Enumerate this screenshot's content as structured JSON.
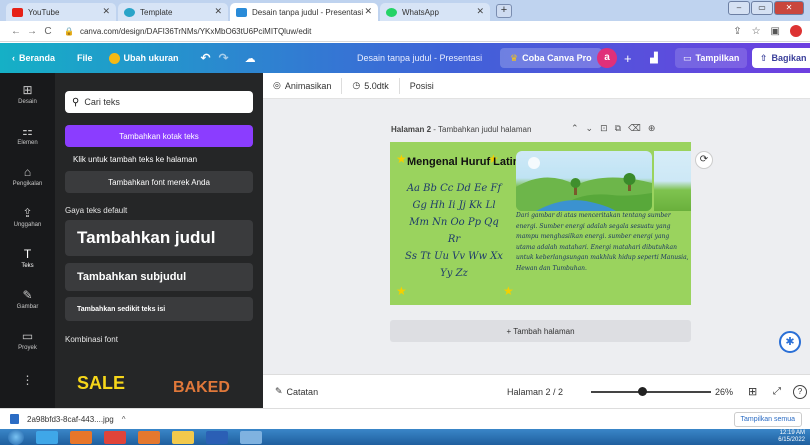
{
  "browser": {
    "tabs": [
      {
        "title": "YouTube",
        "favicon_color": "#e62117",
        "active": false
      },
      {
        "title": "Template",
        "favicon_color": "#2aa4c8",
        "active": false
      },
      {
        "title": "Desain tanpa judul - Presentasi",
        "favicon_color": "#2a8bd8",
        "active": true
      },
      {
        "title": "WhatsApp",
        "favicon_color": "#25d366",
        "active": false
      }
    ],
    "new_tab_label": "+",
    "url": "canva.com/design/DAFI36TrNMs/YKxMbO63tU6PciMITQluw/edit"
  },
  "canva_header": {
    "home_label": "Beranda",
    "file_label": "File",
    "resize_label": "Ubah ukuran",
    "doc_title": "Desain tanpa judul - Presentasi",
    "pro_label": "Coba Canva Pro",
    "user_initial": "a",
    "plus_label": "+",
    "present_label": "Tampilkan",
    "share_label": "Bagikan",
    "accent_color": "#8b3dff"
  },
  "rail": {
    "items": [
      {
        "label": "Desain",
        "icon": "layout-icon",
        "glyph": "⊞"
      },
      {
        "label": "Elemen",
        "icon": "elements-icon",
        "glyph": "⚏"
      },
      {
        "label": "Pengikalan",
        "icon": "brand-icon",
        "glyph": "⌂"
      },
      {
        "label": "Unggahan",
        "icon": "upload-icon",
        "glyph": "⇪"
      },
      {
        "label": "Teks",
        "icon": "text-icon",
        "glyph": "T"
      },
      {
        "label": "Gambar",
        "icon": "draw-icon",
        "glyph": "✎"
      },
      {
        "label": "Proyek",
        "icon": "folder-icon",
        "glyph": "▭"
      },
      {
        "label": "",
        "icon": "apps-icon",
        "glyph": "⋮"
      }
    ]
  },
  "text_panel": {
    "search_placeholder": "Cari teks",
    "add_textbox_label": "Tambahkan kotak teks",
    "click_hint": "Klik untuk tambah teks ke halaman",
    "add_brand_font_label": "Tambahkan font merek Anda",
    "default_styles_label": "Gaya teks default",
    "heading_label": "Tambahkan judul",
    "subheading_label": "Tambahkan subjudul",
    "body_label": "Tambahkan sedikit teks isi",
    "font_combos_label": "Kombinasi font",
    "combo_sale": "SALE",
    "combo_baked": "BAKED"
  },
  "editor": {
    "toolbar": {
      "animate_label": "Animasikan",
      "duration_label": "5.0dtk",
      "position_label": "Posisi"
    },
    "page": {
      "page_label": "Halaman 2",
      "separator": " - ",
      "page_title_placeholder": "Tambahkan judul halaman"
    },
    "slide": {
      "title": "Mengenal Huruf Latin",
      "alphabet_lines": [
        "Aa Bb Cc Dd Ee Ff",
        "Gg Hh Ii Jj Kk Ll",
        "Mm Nn Oo Pp Qq Rr",
        "Ss Tt Uu Vv Ww Xx",
        "Yy Zz"
      ],
      "paragraph": "Dari gambar di atas menceritakan tentang sumber energi. Sumber energi adalah segala sesuatu yang mampu menghasilkan energi. sumber energi yang utama adalah matahari. Energi matahari dibutuhkan untuk keberlangsungan makhluk hidup seperti Manusia, Hewan dan Tumbuhan.",
      "background_color": "#9ad35e"
    },
    "add_page_label": "+ Tambah halaman",
    "bottom": {
      "notes_label": "Catatan",
      "page_indicator": "Halaman 2 / 2",
      "zoom": "26%",
      "zoom_fraction": 0.26
    }
  },
  "downloads": {
    "file_name": "2a98bfd3-8caf-443....jpg",
    "show_all_label": "Tampilkan semua"
  },
  "taskbar": {
    "time": "12:19 AM",
    "date": "6/15/2022"
  }
}
